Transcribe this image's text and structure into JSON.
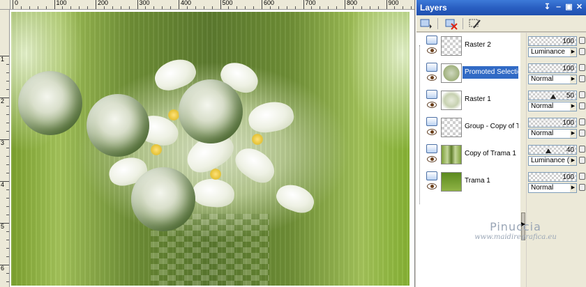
{
  "canvas": {
    "ruler_h_labels": [
      "0",
      "100",
      "200",
      "300",
      "400",
      "500",
      "600",
      "700",
      "800",
      "900"
    ],
    "ruler_v_labels": [
      "1",
      "2",
      "3",
      "4",
      "5",
      "6"
    ]
  },
  "layers_panel": {
    "title": "Layers",
    "title_buttons": [
      "pin-icon",
      "minimize-icon",
      "restore-icon",
      "close-icon"
    ],
    "toolbar": [
      "new-layer-icon",
      "delete-layer-icon",
      "edit-layer-icon"
    ],
    "layers": [
      {
        "name": "Raster 2",
        "opacity": "100",
        "blend_mode": "Luminance",
        "selected": false
      },
      {
        "name": "Promoted Selection",
        "opacity": "100",
        "blend_mode": "Normal",
        "selected": true
      },
      {
        "name": "Raster 1",
        "opacity": "50",
        "blend_mode": "Normal",
        "selected": false
      },
      {
        "name": "Group - Copy of Tr",
        "opacity": "100",
        "blend_mode": "Normal",
        "selected": false
      },
      {
        "name": "Copy of Trama 1",
        "opacity": "40",
        "blend_mode": "Luminance (L)",
        "selected": false
      },
      {
        "name": "Trama 1",
        "opacity": "100",
        "blend_mode": "Normal",
        "selected": false
      }
    ]
  },
  "watermark": {
    "name": "Pinuccia",
    "url": "www.maidiregrafica.eu"
  },
  "colors": {
    "titlebar": "#2a5fc2",
    "selection": "#316ac5",
    "image_green": "#6f8f36"
  }
}
